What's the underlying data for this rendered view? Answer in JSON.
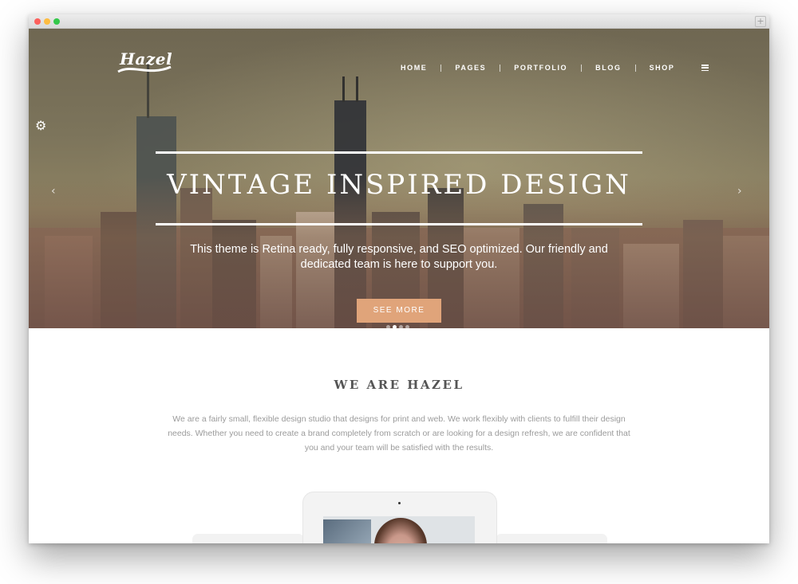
{
  "browser": {
    "new_tab_icon": "plus-icon",
    "new_tab_glyph": "+"
  },
  "header": {
    "logo_text": "Hazel",
    "nav": [
      {
        "label": "HOME"
      },
      {
        "label": "PAGES"
      },
      {
        "label": "PORTFOLIO"
      },
      {
        "label": "BLOG"
      },
      {
        "label": "SHOP"
      }
    ],
    "menu_icon": "hamburger-menu-icon"
  },
  "hero": {
    "title": "VINTAGE INSPIRED DESIGN",
    "subtitle": "This theme is Retina ready, fully responsive, and SEO optimized. Our friendly and dedicated team is here to support you.",
    "button_label": "SEE MORE",
    "slide_count": 4,
    "active_slide": 2,
    "prev_icon": "chevron-left-icon",
    "next_icon": "chevron-right-icon",
    "settings_icon": "gear-icon",
    "button_color": "#e0a47a"
  },
  "about": {
    "title": "WE ARE HAZEL",
    "text": "We are a fairly small, flexible design studio that designs for print and web. We work flexibly with clients to fulfill their design needs. Whether you need to create a brand completely from scratch or are looking for a design refresh, we are confident that you and your team will be satisfied with the results."
  }
}
